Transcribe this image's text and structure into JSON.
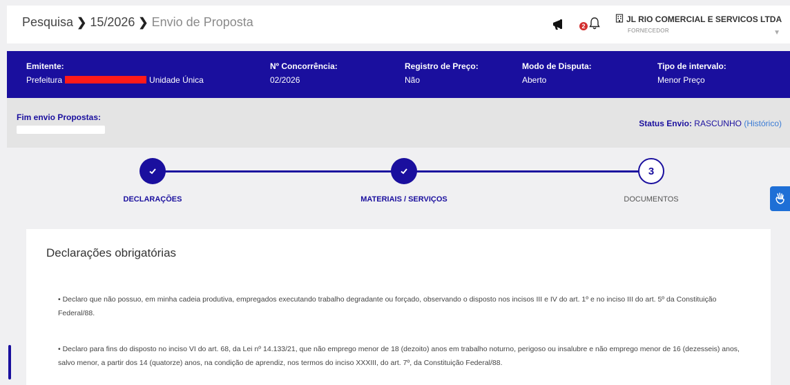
{
  "header": {
    "breadcrumb": [
      "Pesquisa",
      "15/2026",
      "Envio de Proposta"
    ],
    "notification_count": "2",
    "company_name": "JL RIO COMERCIAL E SERVICOS LTDA",
    "company_role": "FORNECEDOR"
  },
  "summary": {
    "emitente_label": "Emitente:",
    "emitente_prefix": "Prefeitura",
    "emitente_suffix": "Unidade Única",
    "concorrencia_label": "Nº Concorrência:",
    "concorrencia_value": "02/2026",
    "registro_label": "Registro de Preço:",
    "registro_value": "Não",
    "modo_label": "Modo de Disputa:",
    "modo_value": "Aberto",
    "intervalo_label": "Tipo de intervalo:",
    "intervalo_value": "Menor Preço"
  },
  "info": {
    "fim_label": "Fim envio Propostas:",
    "status_label": "Status Envio:",
    "status_value": "RASCUNHO",
    "historico_link": "Histórico"
  },
  "steps": [
    {
      "label": "DECLARAÇÕES",
      "state": "done"
    },
    {
      "label": "MATERIAIS / SERVIÇOS",
      "state": "done"
    },
    {
      "label": "DOCUMENTOS",
      "state": "pending",
      "number": "3"
    }
  ],
  "card": {
    "title": "Declarações obrigatórias",
    "declarations": [
      "• Declaro que não possuo, em minha cadeia produtiva, empregados executando trabalho degradante ou forçado, observando o disposto nos incisos III e IV do art. 1º e no inciso III do art. 5º da Constituição Federal/88.",
      "• Declaro para fins do disposto no inciso VI do art. 68, da Lei nº 14.133/21, que não emprego menor de 18 (dezoito) anos em trabalho noturno, perigoso ou insalubre e não emprego menor de 16 (dezesseis) anos, salvo menor, a partir dos 14 (quatorze) anos, na condição de aprendiz, nos termos do inciso XXXIII, do art. 7º, da Constituição Federal/88."
    ]
  },
  "colors": {
    "primary": "#1a0f9e",
    "link": "#3a7bd5",
    "badge": "#d32f2f",
    "a11y": "#1e6fd6"
  },
  "icons": [
    "megaphone-icon",
    "bell-icon",
    "building-icon",
    "check-icon",
    "accessibility-icon"
  ]
}
